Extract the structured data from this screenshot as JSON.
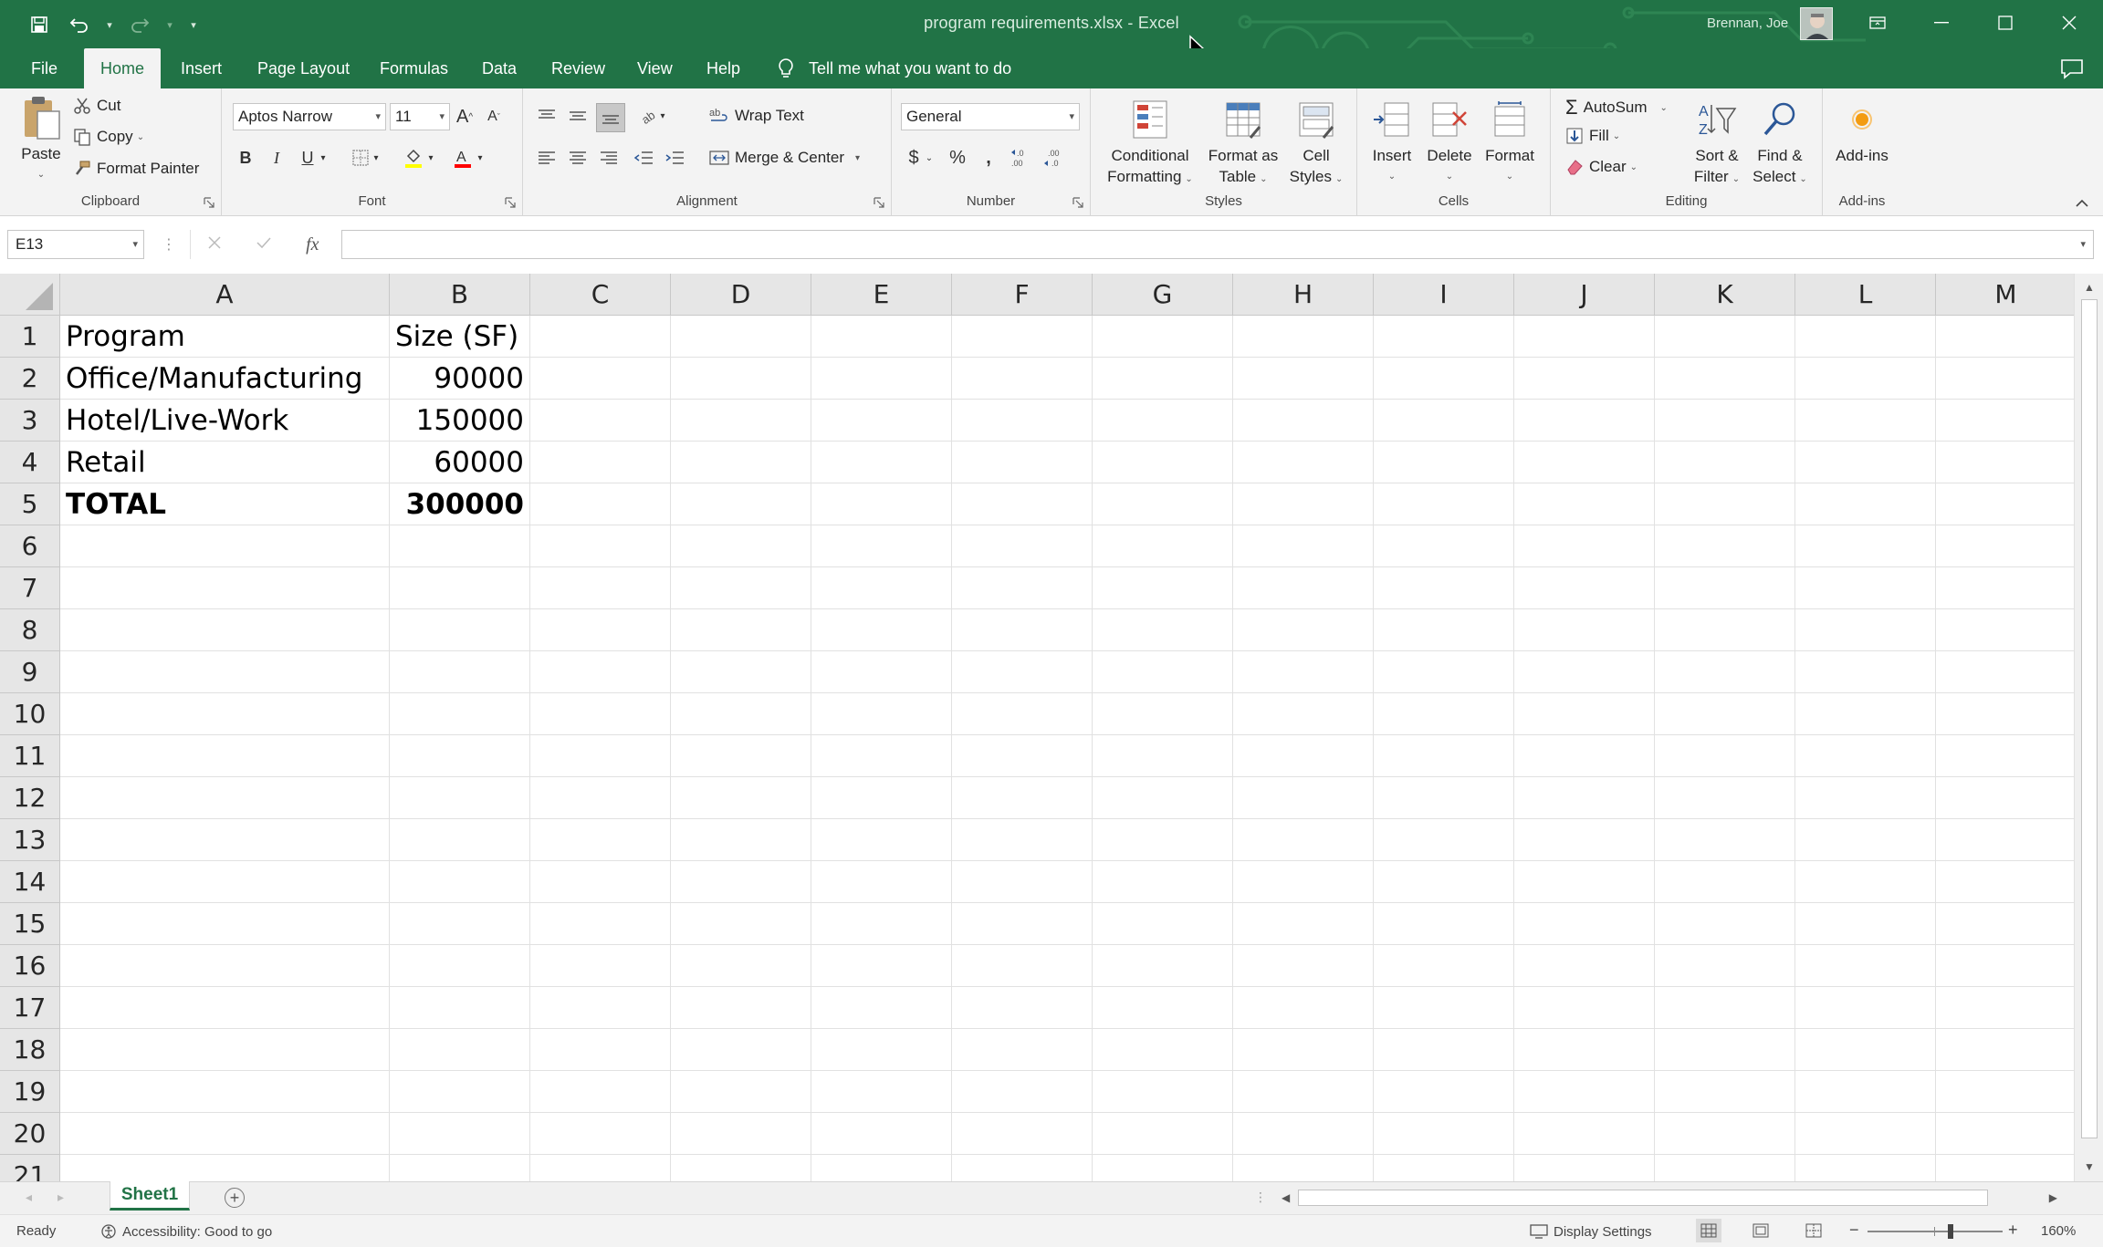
{
  "window": {
    "title": "program requirements.xlsx  -  Excel",
    "user_name": "Brennan, Joe"
  },
  "tabs": [
    {
      "label": "File"
    },
    {
      "label": "Home"
    },
    {
      "label": "Insert"
    },
    {
      "label": "Page Layout"
    },
    {
      "label": "Formulas"
    },
    {
      "label": "Data"
    },
    {
      "label": "Review"
    },
    {
      "label": "View"
    },
    {
      "label": "Help"
    }
  ],
  "tell_me": "Tell me what you want to do",
  "ribbon": {
    "clipboard": {
      "label": "Clipboard",
      "paste": "Paste",
      "cut": "Cut",
      "copy": "Copy",
      "format_painter": "Format Painter"
    },
    "font": {
      "label": "Font",
      "font_name": "Aptos Narrow",
      "font_size": "11"
    },
    "alignment": {
      "label": "Alignment",
      "wrap_text": "Wrap Text",
      "merge_center": "Merge & Center"
    },
    "number": {
      "label": "Number",
      "format": "General"
    },
    "styles": {
      "label": "Styles",
      "conditional_1": "Conditional",
      "conditional_2": "Formatting",
      "format_table_1": "Format as",
      "format_table_2": "Table",
      "cell_styles_1": "Cell",
      "cell_styles_2": "Styles"
    },
    "cells": {
      "label": "Cells",
      "insert": "Insert",
      "delete": "Delete",
      "format": "Format"
    },
    "editing": {
      "label": "Editing",
      "autosum": "AutoSum",
      "fill": "Fill",
      "clear": "Clear",
      "sort_1": "Sort &",
      "sort_2": "Filter",
      "find_1": "Find &",
      "find_2": "Select"
    },
    "addins": {
      "label": "Add-ins",
      "addins": "Add-ins"
    }
  },
  "formula_bar": {
    "name_box": "E13",
    "formula": ""
  },
  "columns": [
    "A",
    "B",
    "C",
    "D",
    "E",
    "F",
    "G",
    "H",
    "I",
    "J",
    "K",
    "L",
    "M"
  ],
  "rows": [
    {
      "n": "1",
      "a": "Program",
      "b": "Size (SF)"
    },
    {
      "n": "2",
      "a": "Office/Manufacturing",
      "b": "90000"
    },
    {
      "n": "3",
      "a": "Hotel/Live-Work",
      "b": "150000"
    },
    {
      "n": "4",
      "a": "Retail",
      "b": "60000"
    },
    {
      "n": "5",
      "a": "TOTAL",
      "b": "300000"
    },
    {
      "n": "6",
      "a": "",
      "b": ""
    },
    {
      "n": "7",
      "a": "",
      "b": ""
    },
    {
      "n": "8",
      "a": "",
      "b": ""
    },
    {
      "n": "9",
      "a": "",
      "b": ""
    },
    {
      "n": "10",
      "a": "",
      "b": ""
    },
    {
      "n": "11",
      "a": "",
      "b": ""
    },
    {
      "n": "12",
      "a": "",
      "b": ""
    },
    {
      "n": "13",
      "a": "",
      "b": ""
    },
    {
      "n": "14",
      "a": "",
      "b": ""
    },
    {
      "n": "15",
      "a": "",
      "b": ""
    },
    {
      "n": "16",
      "a": "",
      "b": ""
    },
    {
      "n": "17",
      "a": "",
      "b": ""
    },
    {
      "n": "18",
      "a": "",
      "b": ""
    },
    {
      "n": "19",
      "a": "",
      "b": ""
    },
    {
      "n": "20",
      "a": "",
      "b": ""
    },
    {
      "n": "21",
      "a": "",
      "b": ""
    }
  ],
  "sheet_tabs": [
    {
      "label": "Sheet1"
    }
  ],
  "status": {
    "ready": "Ready",
    "accessibility": "Accessibility: Good to go",
    "display_settings": "Display Settings",
    "zoom": "160%"
  },
  "colors": {
    "accent": "#217346"
  }
}
